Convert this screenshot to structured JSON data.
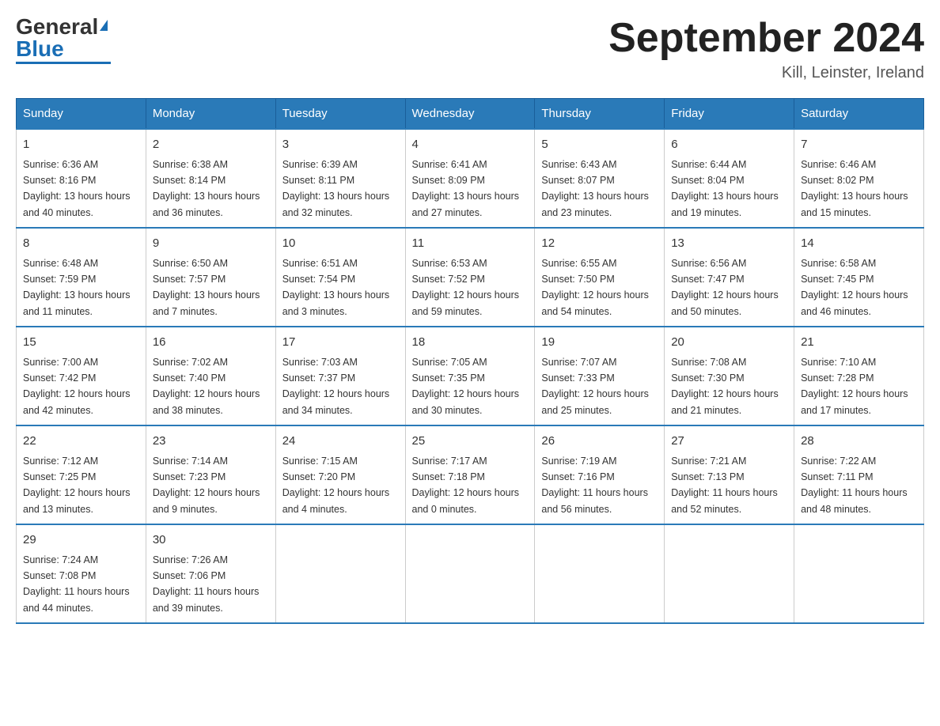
{
  "header": {
    "logo_main": "General",
    "logo_sub": "Blue",
    "title": "September 2024",
    "subtitle": "Kill, Leinster, Ireland"
  },
  "days_of_week": [
    "Sunday",
    "Monday",
    "Tuesday",
    "Wednesday",
    "Thursday",
    "Friday",
    "Saturday"
  ],
  "weeks": [
    [
      {
        "num": "1",
        "sunrise": "6:36 AM",
        "sunset": "8:16 PM",
        "daylight": "13 hours and 40 minutes."
      },
      {
        "num": "2",
        "sunrise": "6:38 AM",
        "sunset": "8:14 PM",
        "daylight": "13 hours and 36 minutes."
      },
      {
        "num": "3",
        "sunrise": "6:39 AM",
        "sunset": "8:11 PM",
        "daylight": "13 hours and 32 minutes."
      },
      {
        "num": "4",
        "sunrise": "6:41 AM",
        "sunset": "8:09 PM",
        "daylight": "13 hours and 27 minutes."
      },
      {
        "num": "5",
        "sunrise": "6:43 AM",
        "sunset": "8:07 PM",
        "daylight": "13 hours and 23 minutes."
      },
      {
        "num": "6",
        "sunrise": "6:44 AM",
        "sunset": "8:04 PM",
        "daylight": "13 hours and 19 minutes."
      },
      {
        "num": "7",
        "sunrise": "6:46 AM",
        "sunset": "8:02 PM",
        "daylight": "13 hours and 15 minutes."
      }
    ],
    [
      {
        "num": "8",
        "sunrise": "6:48 AM",
        "sunset": "7:59 PM",
        "daylight": "13 hours and 11 minutes."
      },
      {
        "num": "9",
        "sunrise": "6:50 AM",
        "sunset": "7:57 PM",
        "daylight": "13 hours and 7 minutes."
      },
      {
        "num": "10",
        "sunrise": "6:51 AM",
        "sunset": "7:54 PM",
        "daylight": "13 hours and 3 minutes."
      },
      {
        "num": "11",
        "sunrise": "6:53 AM",
        "sunset": "7:52 PM",
        "daylight": "12 hours and 59 minutes."
      },
      {
        "num": "12",
        "sunrise": "6:55 AM",
        "sunset": "7:50 PM",
        "daylight": "12 hours and 54 minutes."
      },
      {
        "num": "13",
        "sunrise": "6:56 AM",
        "sunset": "7:47 PM",
        "daylight": "12 hours and 50 minutes."
      },
      {
        "num": "14",
        "sunrise": "6:58 AM",
        "sunset": "7:45 PM",
        "daylight": "12 hours and 46 minutes."
      }
    ],
    [
      {
        "num": "15",
        "sunrise": "7:00 AM",
        "sunset": "7:42 PM",
        "daylight": "12 hours and 42 minutes."
      },
      {
        "num": "16",
        "sunrise": "7:02 AM",
        "sunset": "7:40 PM",
        "daylight": "12 hours and 38 minutes."
      },
      {
        "num": "17",
        "sunrise": "7:03 AM",
        "sunset": "7:37 PM",
        "daylight": "12 hours and 34 minutes."
      },
      {
        "num": "18",
        "sunrise": "7:05 AM",
        "sunset": "7:35 PM",
        "daylight": "12 hours and 30 minutes."
      },
      {
        "num": "19",
        "sunrise": "7:07 AM",
        "sunset": "7:33 PM",
        "daylight": "12 hours and 25 minutes."
      },
      {
        "num": "20",
        "sunrise": "7:08 AM",
        "sunset": "7:30 PM",
        "daylight": "12 hours and 21 minutes."
      },
      {
        "num": "21",
        "sunrise": "7:10 AM",
        "sunset": "7:28 PM",
        "daylight": "12 hours and 17 minutes."
      }
    ],
    [
      {
        "num": "22",
        "sunrise": "7:12 AM",
        "sunset": "7:25 PM",
        "daylight": "12 hours and 13 minutes."
      },
      {
        "num": "23",
        "sunrise": "7:14 AM",
        "sunset": "7:23 PM",
        "daylight": "12 hours and 9 minutes."
      },
      {
        "num": "24",
        "sunrise": "7:15 AM",
        "sunset": "7:20 PM",
        "daylight": "12 hours and 4 minutes."
      },
      {
        "num": "25",
        "sunrise": "7:17 AM",
        "sunset": "7:18 PM",
        "daylight": "12 hours and 0 minutes."
      },
      {
        "num": "26",
        "sunrise": "7:19 AM",
        "sunset": "7:16 PM",
        "daylight": "11 hours and 56 minutes."
      },
      {
        "num": "27",
        "sunrise": "7:21 AM",
        "sunset": "7:13 PM",
        "daylight": "11 hours and 52 minutes."
      },
      {
        "num": "28",
        "sunrise": "7:22 AM",
        "sunset": "7:11 PM",
        "daylight": "11 hours and 48 minutes."
      }
    ],
    [
      {
        "num": "29",
        "sunrise": "7:24 AM",
        "sunset": "7:08 PM",
        "daylight": "11 hours and 44 minutes."
      },
      {
        "num": "30",
        "sunrise": "7:26 AM",
        "sunset": "7:06 PM",
        "daylight": "11 hours and 39 minutes."
      },
      null,
      null,
      null,
      null,
      null
    ]
  ],
  "labels": {
    "sunrise": "Sunrise:",
    "sunset": "Sunset:",
    "daylight": "Daylight:"
  }
}
